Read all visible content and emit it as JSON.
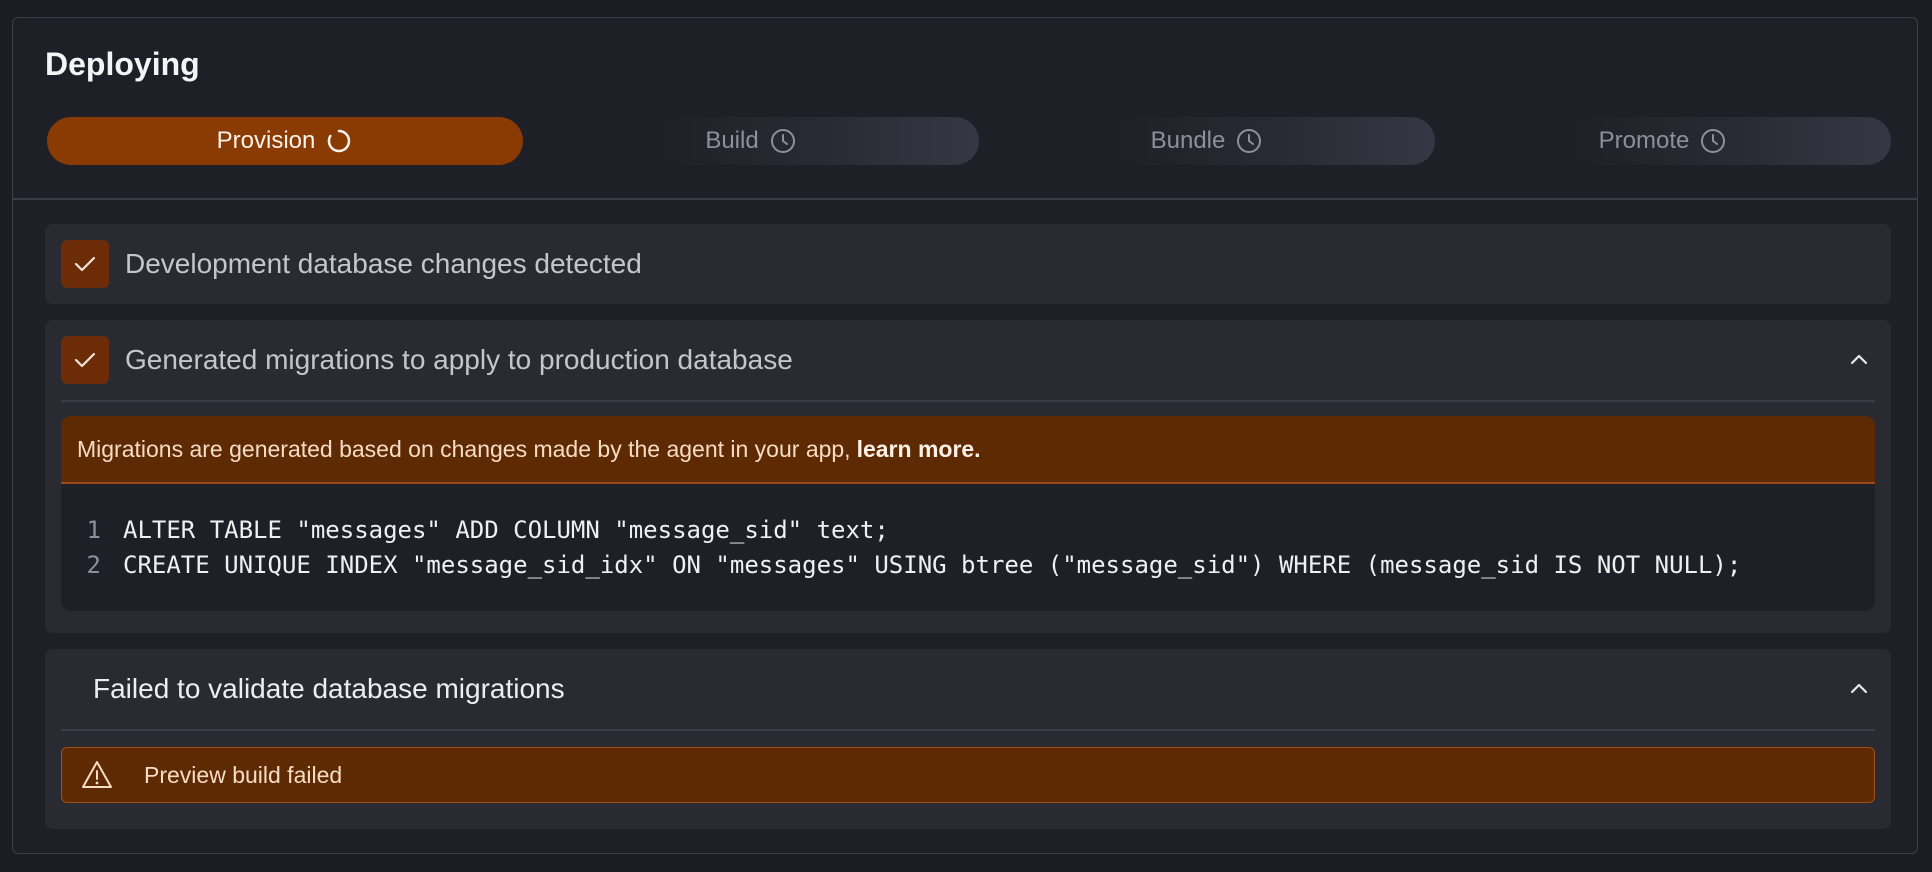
{
  "header": {
    "title": "Deploying"
  },
  "steps": [
    {
      "label": "Provision",
      "state": "active",
      "icon": "spinner-icon"
    },
    {
      "label": "Build",
      "state": "pending",
      "icon": "clock-icon"
    },
    {
      "label": "Bundle",
      "state": "pending",
      "icon": "clock-icon"
    },
    {
      "label": "Promote",
      "state": "pending",
      "icon": "clock-icon"
    }
  ],
  "sections": {
    "changes": {
      "title": "Development database changes detected",
      "icon": "checkmark-icon"
    },
    "migrations": {
      "title": "Generated migrations to apply to production database",
      "icon": "checkmark-icon",
      "toggle_icon": "chevron-up-icon",
      "banner_text": "Migrations are generated based on changes made by the agent in your app,",
      "banner_link": "learn more.",
      "code": [
        {
          "num": "1",
          "text": "ALTER TABLE \"messages\" ADD COLUMN \"message_sid\" text;"
        },
        {
          "num": "2",
          "text": "CREATE UNIQUE INDEX \"message_sid_idx\" ON \"messages\" USING btree (\"message_sid\") WHERE (message_sid IS NOT NULL);"
        }
      ]
    },
    "validation": {
      "title": "Failed to validate database migrations",
      "toggle_icon": "chevron-up-icon",
      "error_icon": "warning-icon",
      "error_text": "Preview build failed"
    }
  },
  "colors": {
    "accent": "#8a3b04",
    "banner": "#5e2a04",
    "background": "#1f2027",
    "card": "#2a2b32"
  }
}
